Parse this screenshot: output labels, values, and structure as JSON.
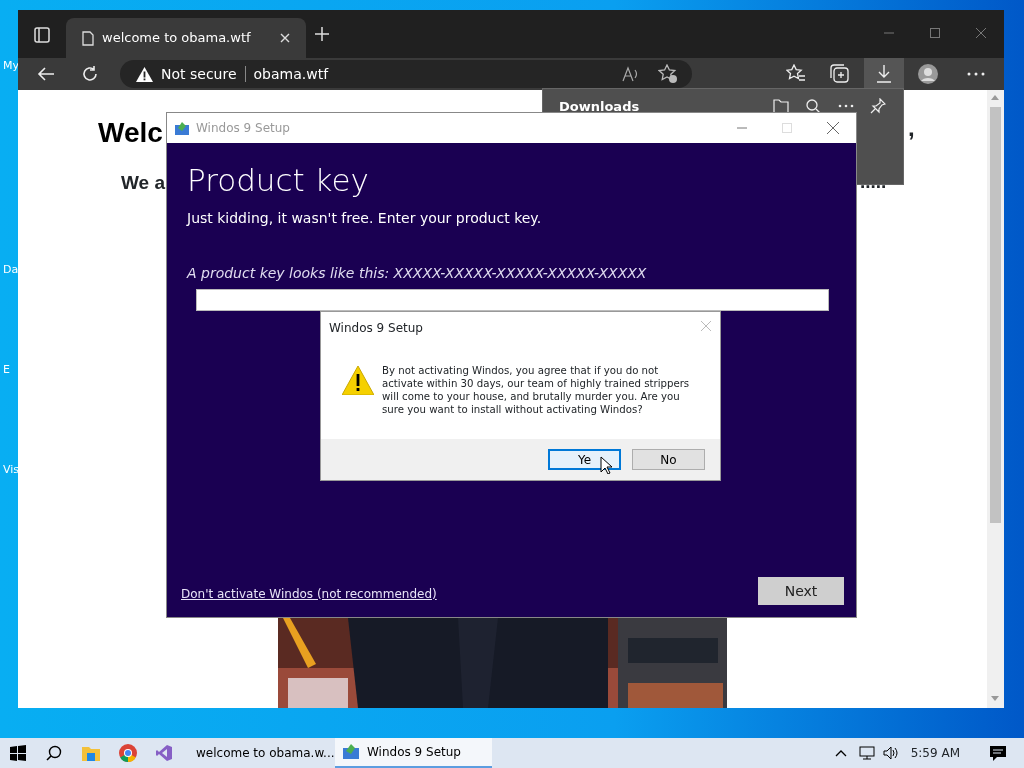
{
  "desktop_icons": [
    {
      "label": "My"
    },
    {
      "label": "Da"
    },
    {
      "label": "E"
    },
    {
      "label": "Vis"
    }
  ],
  "browser": {
    "tab": {
      "title": "welcome to obama.wtf",
      "selected": true
    },
    "security": "Not secure",
    "url": "obama.wtf",
    "page": {
      "heading": "Welc",
      "heading_tail": ",",
      "subheading": "We a",
      "subheading_tail": "....."
    },
    "downloads": {
      "title": "Downloads"
    }
  },
  "setup": {
    "title": "Windos 9 Setup",
    "heading": "Product key",
    "subtitle": "Just kidding, it wasn't free. Enter your product key.",
    "hint": "A product key looks like this: XXXXX-XXXXX-XXXXX-XXXXX-XXXXX",
    "skip_link": "Don't activate Windos (not recommended)",
    "next": "Next"
  },
  "message_box": {
    "title": "Windos 9 Setup",
    "message": "By not activating Windos, you agree that if you do not activate within 30 days, our team of highly trained strippers will come to your house, and brutally murder you. Are you sure you want to install without activating Windos?",
    "buttons": [
      {
        "label": "Ye",
        "selected": true
      },
      {
        "label": "No",
        "selected": false
      }
    ]
  },
  "taskbar": {
    "tasks": [
      {
        "label": "welcome to obama.w...",
        "kind": "browser",
        "selected": false
      },
      {
        "label": "Windos 9 Setup",
        "kind": "setup",
        "selected": true
      }
    ],
    "clock": "5:59 AM"
  }
}
